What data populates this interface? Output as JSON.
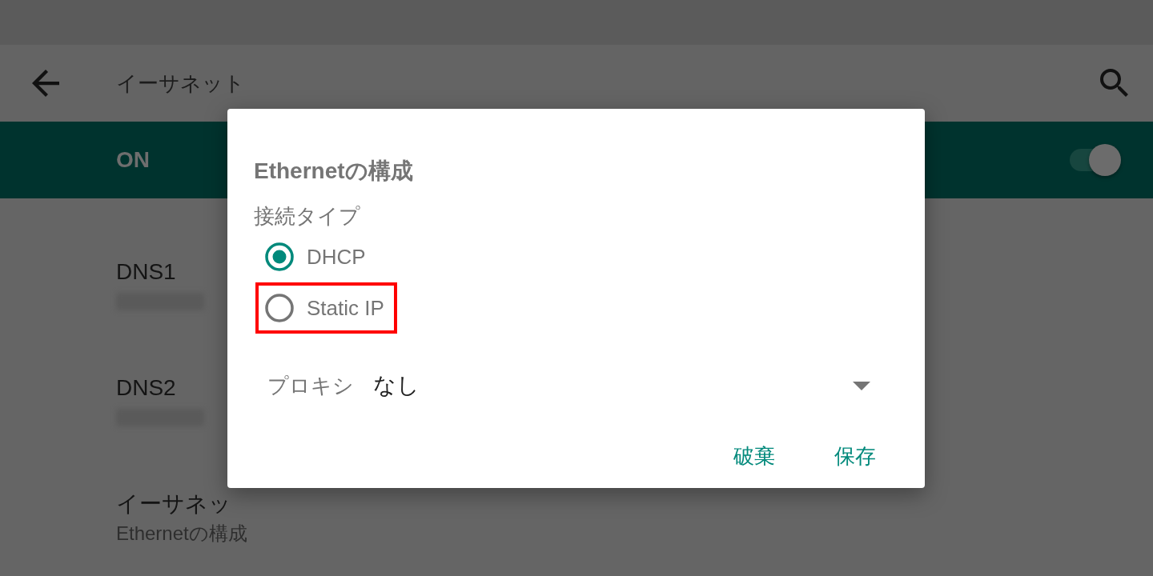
{
  "app_bar": {
    "title": "イーサネット"
  },
  "master_switch": {
    "label": "ON",
    "on": true
  },
  "settings": [
    {
      "title": "DNS1",
      "value_redacted": true
    },
    {
      "title": "DNS2",
      "value_redacted": true
    },
    {
      "title": "イーサネッ",
      "subtitle": "Ethernetの構成"
    }
  ],
  "dialog": {
    "title": "Ethernetの構成",
    "connection_type_label": "接続タイプ",
    "options": [
      {
        "label": "DHCP",
        "selected": true,
        "highlighted": false
      },
      {
        "label": "Static IP",
        "selected": false,
        "highlighted": true
      }
    ],
    "proxy": {
      "label": "プロキシ",
      "value": "なし"
    },
    "buttons": [
      "破棄",
      "保存"
    ]
  }
}
